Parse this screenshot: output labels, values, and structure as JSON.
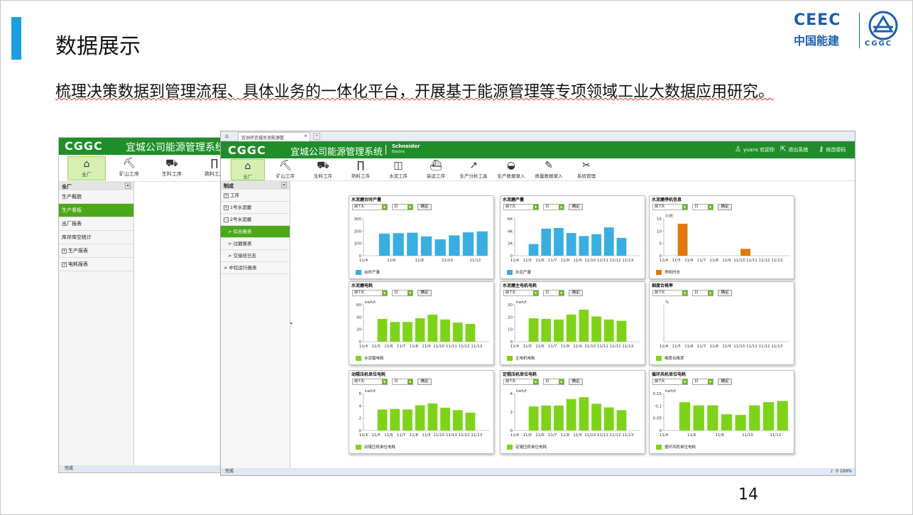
{
  "slide": {
    "title": "数据展示",
    "body": "梳理决策数据到管理流程、具体业务的一体化平台，开展基于能源管理等专项领域工业大数据应用研究。",
    "page": "14"
  },
  "logo": {
    "ceec": "CEEC",
    "cn": "中国能建",
    "cggc": "CGGC"
  },
  "back_window": {
    "logo": "CGGC",
    "system": "宜城公司能源管理系统",
    "nav": [
      {
        "label": "全厂",
        "icon": "factory-icon"
      },
      {
        "label": "矿山工序",
        "icon": "excavator-icon"
      },
      {
        "label": "生料工序",
        "icon": "truck-icon"
      },
      {
        "label": "熟料工序",
        "icon": "kiln-icon"
      }
    ],
    "side_header": "全厂",
    "side_items": [
      "生产概貌",
      "生产看板",
      "出厂报表",
      "库存库空统计",
      "生产报表",
      "电耗报表"
    ],
    "status": "完成"
  },
  "front_window": {
    "tab": "宜洲环宜城水泥能源管",
    "logo": "CGGC",
    "system": "宜城公司能源管理系统",
    "schneider": "Schneider",
    "electric": "Electric",
    "user": "yuans 欢迎你",
    "logout": "退出系统",
    "change_pwd": "修改密码",
    "nav": [
      {
        "label": "全厂",
        "icon": "factory-icon"
      },
      {
        "label": "矿山工序",
        "icon": "excavator-icon"
      },
      {
        "label": "生料工序",
        "icon": "truck-icon"
      },
      {
        "label": "熟料工序",
        "icon": "kiln-icon"
      },
      {
        "label": "水泥工序",
        "icon": "mill-icon"
      },
      {
        "label": "装运工序",
        "icon": "ship-icon"
      },
      {
        "label": "生产分析工具",
        "icon": "chart-icon"
      },
      {
        "label": "生产数据录入",
        "icon": "helmet-icon"
      },
      {
        "label": "质量数据录入",
        "icon": "pen-icon"
      },
      {
        "label": "系统管理",
        "icon": "tools-icon"
      }
    ],
    "side_header": "制成",
    "side_items": [
      "工序",
      "1号水泥磨",
      "2号水泥磨",
      "> 综合报表",
      "> 过磨报表",
      "> 交接班日志",
      "> 中控运行报表"
    ],
    "status": "完成",
    "status_right": "0   100%"
  },
  "filters": {
    "period": "前7天",
    "unit": "日",
    "confirm": "确定"
  },
  "colors": {
    "blue": "#3aaee0",
    "green": "#7ed31a",
    "orange": "#e0780c",
    "header_green": "#1f8e2a"
  },
  "chart_data": [
    {
      "type": "bar",
      "title": "水泥磨台时产量",
      "ylim": [
        0,
        300
      ],
      "yticks": [
        "0",
        "100",
        "200",
        "300"
      ],
      "ylabel": "",
      "categories": [
        "11/4",
        "11/5",
        "11/6",
        "11/7",
        "11/8",
        "11/9",
        "11/10",
        "11/11",
        "11/12"
      ],
      "xticks": [
        "11/4",
        "11/6",
        "11/8",
        "11/10",
        "11/12"
      ],
      "values": [
        null,
        180,
        183,
        187,
        157,
        133,
        165,
        190,
        198
      ],
      "color": "#3aaee0",
      "legend": "台时产量"
    },
    {
      "type": "bar",
      "title": "水泥磨产量",
      "ylim": [
        0,
        6000
      ],
      "yticks": [
        "0",
        "2K",
        "4K",
        "6K"
      ],
      "ylabel": "",
      "categories": [
        "11/4",
        "11/5",
        "11/6",
        "11/7",
        "11/8",
        "11/9",
        "11/10",
        "11/11",
        "11/12",
        "11/13"
      ],
      "xticks": [
        "11/4",
        "11/5",
        "11/6",
        "11/7",
        "11/8",
        "11/9",
        "11/10",
        "11/11",
        "11/12",
        "11/13"
      ],
      "values": [
        null,
        1900,
        4400,
        4500,
        3700,
        3200,
        3500,
        4600,
        2900,
        null
      ],
      "color": "#3aaee0",
      "legend": "水泥产量"
    },
    {
      "type": "bar",
      "title": "水泥磨停机信息",
      "ylim": [
        0,
        15
      ],
      "yticks": [
        "0",
        "5",
        "10",
        "15"
      ],
      "ylabel": "小时",
      "categories": [
        "11/4",
        "11/5",
        "11/6",
        "11/7",
        "11/8",
        "11/9",
        "11/10",
        "11/11",
        "11/12",
        "11/13"
      ],
      "xticks": [
        "11/4",
        "11/5",
        "11/6",
        "11/7",
        "11/8",
        "11/9",
        "11/10",
        "11/11",
        "11/12",
        "11/13"
      ],
      "values": [
        null,
        13,
        null,
        null,
        null,
        null,
        2.8,
        null,
        null,
        null
      ],
      "color": "#e0780c",
      "legend": "停机时长"
    },
    {
      "type": "bar",
      "title": "水泥磨电耗",
      "ylim": [
        0,
        60
      ],
      "yticks": [
        "0",
        "20",
        "40",
        "60"
      ],
      "ylabel": "kwh/t",
      "categories": [
        "11/4",
        "11/5",
        "11/6",
        "11/7",
        "11/8",
        "11/9",
        "11/10",
        "11/11",
        "11/12",
        "11/13"
      ],
      "xticks": [
        "11/4",
        "11/5",
        "11/6",
        "11/7",
        "11/8",
        "11/9",
        "11/10",
        "11/11",
        "11/12",
        "11/13"
      ],
      "values": [
        null,
        37,
        32,
        32,
        38,
        44,
        36,
        31,
        29,
        null
      ],
      "color": "#7ed31a",
      "legend": "水泥磨电耗"
    },
    {
      "type": "bar",
      "title": "水泥磨主电机电耗",
      "ylim": [
        0,
        30
      ],
      "yticks": [
        "0",
        "10",
        "20",
        "30"
      ],
      "ylabel": "kwh/t",
      "categories": [
        "11/4",
        "11/5",
        "11/6",
        "11/7",
        "11/8",
        "11/9",
        "11/10",
        "11/11",
        "11/12",
        "11/13"
      ],
      "xticks": [
        "11/4",
        "11/5",
        "11/6",
        "11/7",
        "11/8",
        "11/9",
        "11/10",
        "11/11",
        "11/12",
        "11/13"
      ],
      "values": [
        null,
        19,
        18.5,
        18,
        22,
        26,
        20.5,
        18,
        17,
        null
      ],
      "color": "#7ed31a",
      "legend": "主电机电耗"
    },
    {
      "type": "bar",
      "title": "细度合格率",
      "ylim": [
        0,
        1
      ],
      "yticks": [],
      "ylabel": "%",
      "categories": [
        "11/4",
        "11/5",
        "11/6",
        "11/7",
        "11/8",
        "11/9",
        "11/10",
        "11/11",
        "11/12",
        "11/13"
      ],
      "xticks": [
        "11/4",
        "11/5",
        "11/6",
        "11/7",
        "11/8",
        "11/9",
        "11/10",
        "11/11",
        "11/12",
        "11/13"
      ],
      "values": [
        null,
        null,
        null,
        null,
        null,
        null,
        null,
        null,
        null,
        null
      ],
      "color": "#7ed31a",
      "legend": "细度合格率"
    },
    {
      "type": "bar",
      "title": "动辊压机单位电耗",
      "ylim": [
        0,
        6
      ],
      "yticks": [
        "0",
        "2",
        "4",
        "6"
      ],
      "ylabel": "kwh/t",
      "categories": [
        "11/4",
        "11/5",
        "11/6",
        "11/7",
        "11/8",
        "11/9",
        "11/10",
        "11/11",
        "11/12",
        "11/13"
      ],
      "xticks": [
        "11/4",
        "11/5",
        "11/6",
        "11/7",
        "11/8",
        "11/9",
        "11/10",
        "11/11",
        "11/12",
        "11/13"
      ],
      "values": [
        null,
        3.4,
        3.5,
        3.4,
        4.1,
        4.4,
        3.7,
        3.3,
        2.9,
        null
      ],
      "color": "#7ed31a",
      "legend": "动辊压机单位电耗"
    },
    {
      "type": "bar",
      "title": "定辊压机单位电耗",
      "ylim": [
        0,
        4
      ],
      "yticks": [
        "0",
        "2",
        "4"
      ],
      "ylabel": "kwh/t",
      "categories": [
        "11/4",
        "11/5",
        "11/6",
        "11/7",
        "11/8",
        "11/9",
        "11/10",
        "11/11",
        "11/12",
        "11/13"
      ],
      "xticks": [
        "11/4",
        "11/5",
        "11/6",
        "11/7",
        "11/8",
        "11/9",
        "11/10",
        "11/11",
        "11/12",
        "11/13"
      ],
      "values": [
        null,
        2.6,
        2.7,
        2.7,
        3.4,
        3.6,
        2.9,
        2.5,
        2.2,
        null
      ],
      "color": "#7ed31a",
      "legend": "定辊压机单位电耗"
    },
    {
      "type": "bar",
      "title": "循环风机单位电耗",
      "ylim": [
        0,
        0.15
      ],
      "yticks": [
        "0",
        "0.05",
        "0.1",
        "0.15"
      ],
      "ylabel": "kwh/t",
      "categories": [
        "11/4",
        "11/5",
        "11/6",
        "11/7",
        "11/8",
        "11/9",
        "11/10",
        "11/11",
        "11/12"
      ],
      "xticks": [
        "11/4",
        "11/6",
        "11/8",
        "11/10",
        "11/12"
      ],
      "values": [
        null,
        0.115,
        0.102,
        0.102,
        0.066,
        0.063,
        0.102,
        0.115,
        0.12
      ],
      "color": "#7ed31a",
      "legend": "循环风机单位电耗"
    }
  ]
}
